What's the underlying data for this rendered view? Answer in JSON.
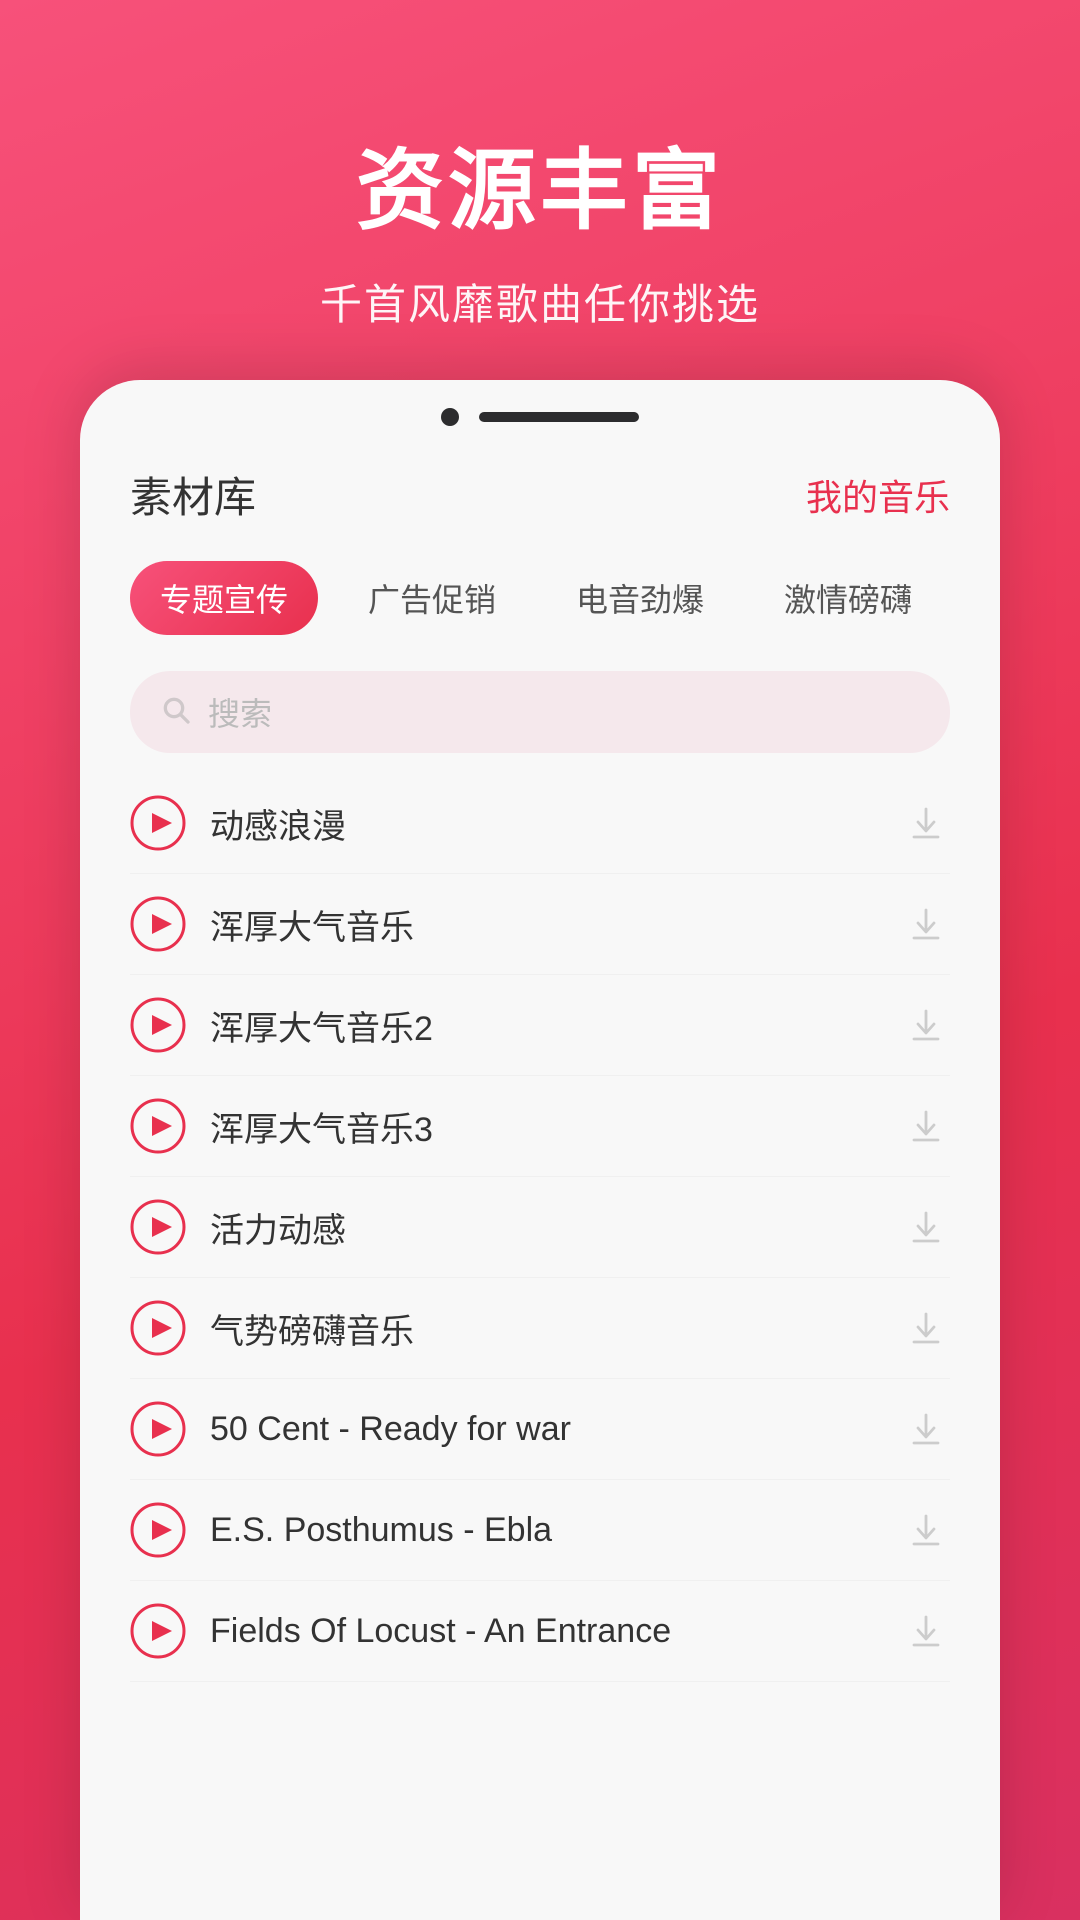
{
  "header": {
    "title": "资源丰富",
    "subtitle": "千首风靡歌曲任你挑选"
  },
  "app": {
    "nav_left": "素材库",
    "nav_right": "我的音乐",
    "tabs": [
      {
        "label": "专题宣传",
        "active": true
      },
      {
        "label": "广告促销",
        "active": false
      },
      {
        "label": "电音劲爆",
        "active": false
      },
      {
        "label": "激情磅礴",
        "active": false
      }
    ],
    "search_placeholder": "搜索",
    "music_items": [
      {
        "name": "动感浪漫"
      },
      {
        "name": "浑厚大气音乐"
      },
      {
        "name": "浑厚大气音乐2"
      },
      {
        "name": "浑厚大气音乐3"
      },
      {
        "name": "活力动感"
      },
      {
        "name": "气势磅礴音乐"
      },
      {
        "name": "50 Cent - Ready for war"
      },
      {
        "name": "E.S. Posthumus - Ebla"
      },
      {
        "name": "Fields Of Locust - An Entrance"
      }
    ]
  },
  "colors": {
    "accent": "#e8304e",
    "accent_gradient_start": "#f7517a",
    "accent_gradient_end": "#e8304e"
  }
}
